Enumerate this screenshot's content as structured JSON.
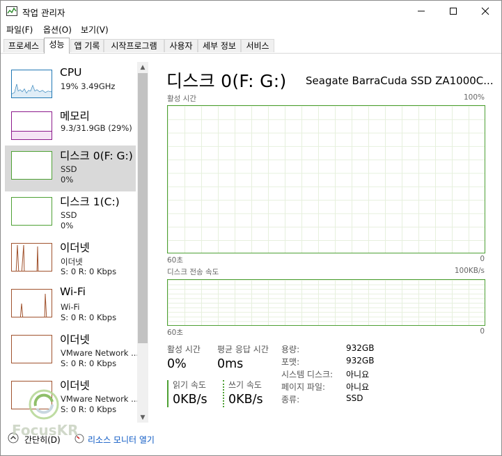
{
  "window": {
    "title": "작업 관리자",
    "accent": "#4da033"
  },
  "menu": [
    "파일(F)",
    "옵션(O)",
    "보기(V)"
  ],
  "tabs": [
    "프로세스",
    "성능",
    "앱 기록",
    "시작프로그램",
    "사용자",
    "세부 정보",
    "서비스"
  ],
  "sidebar": [
    {
      "title": "CPU",
      "sub1": "19% 3.49GHz",
      "sub2": ""
    },
    {
      "title": "메모리",
      "sub1": "9.3/31.9GB (29%)",
      "sub2": ""
    },
    {
      "title": "디스크 0(F: G:)",
      "sub1": "SSD",
      "sub2": "0%"
    },
    {
      "title": "디스크 1(C:)",
      "sub1": "SSD",
      "sub2": "0%"
    },
    {
      "title": "이더넷",
      "sub1": "이더넷",
      "sub2": "S: 0  R: 0 Kbps"
    },
    {
      "title": "Wi-Fi",
      "sub1": "Wi-Fi",
      "sub2": "S: 0  R: 0 Kbps"
    },
    {
      "title": "이더넷",
      "sub1": "VMware Network ...",
      "sub2": "S: 0  R: 0 Kbps"
    },
    {
      "title": "이더넷",
      "sub1": "VMware Network ...",
      "sub2": "S: 0  R: 0 Kbps"
    }
  ],
  "main": {
    "title": "디스크 0(F: G:)",
    "model": "Seagate BarraCuda SSD ZA1000C...",
    "graph1": {
      "label": "활성 시간",
      "max": "100%",
      "left": "60초",
      "right": "0"
    },
    "graph2": {
      "label": "디스크 전송 속도",
      "max": "100KB/s",
      "left": "60초",
      "right": "0"
    },
    "active_time_label": "활성 시간",
    "active_time_value": "0%",
    "response_label": "평균 응답 시간",
    "response_value": "0ms",
    "read_label": "읽기 속도",
    "read_value": "0KB/s",
    "write_label": "쓰기 속도",
    "write_value": "0KB/s",
    "properties": [
      {
        "key": "용량:",
        "value": "932GB"
      },
      {
        "key": "포맷:",
        "value": "932GB"
      },
      {
        "key": "시스템 디스크:",
        "value": "아니요"
      },
      {
        "key": "페이지 파일:",
        "value": "아니요"
      },
      {
        "key": "종류:",
        "value": "SSD"
      }
    ]
  },
  "footer": {
    "brief_label": "간단히(D)",
    "resource_monitor_label": "리소스 모니터 열기"
  },
  "watermark": "FocusKR"
}
